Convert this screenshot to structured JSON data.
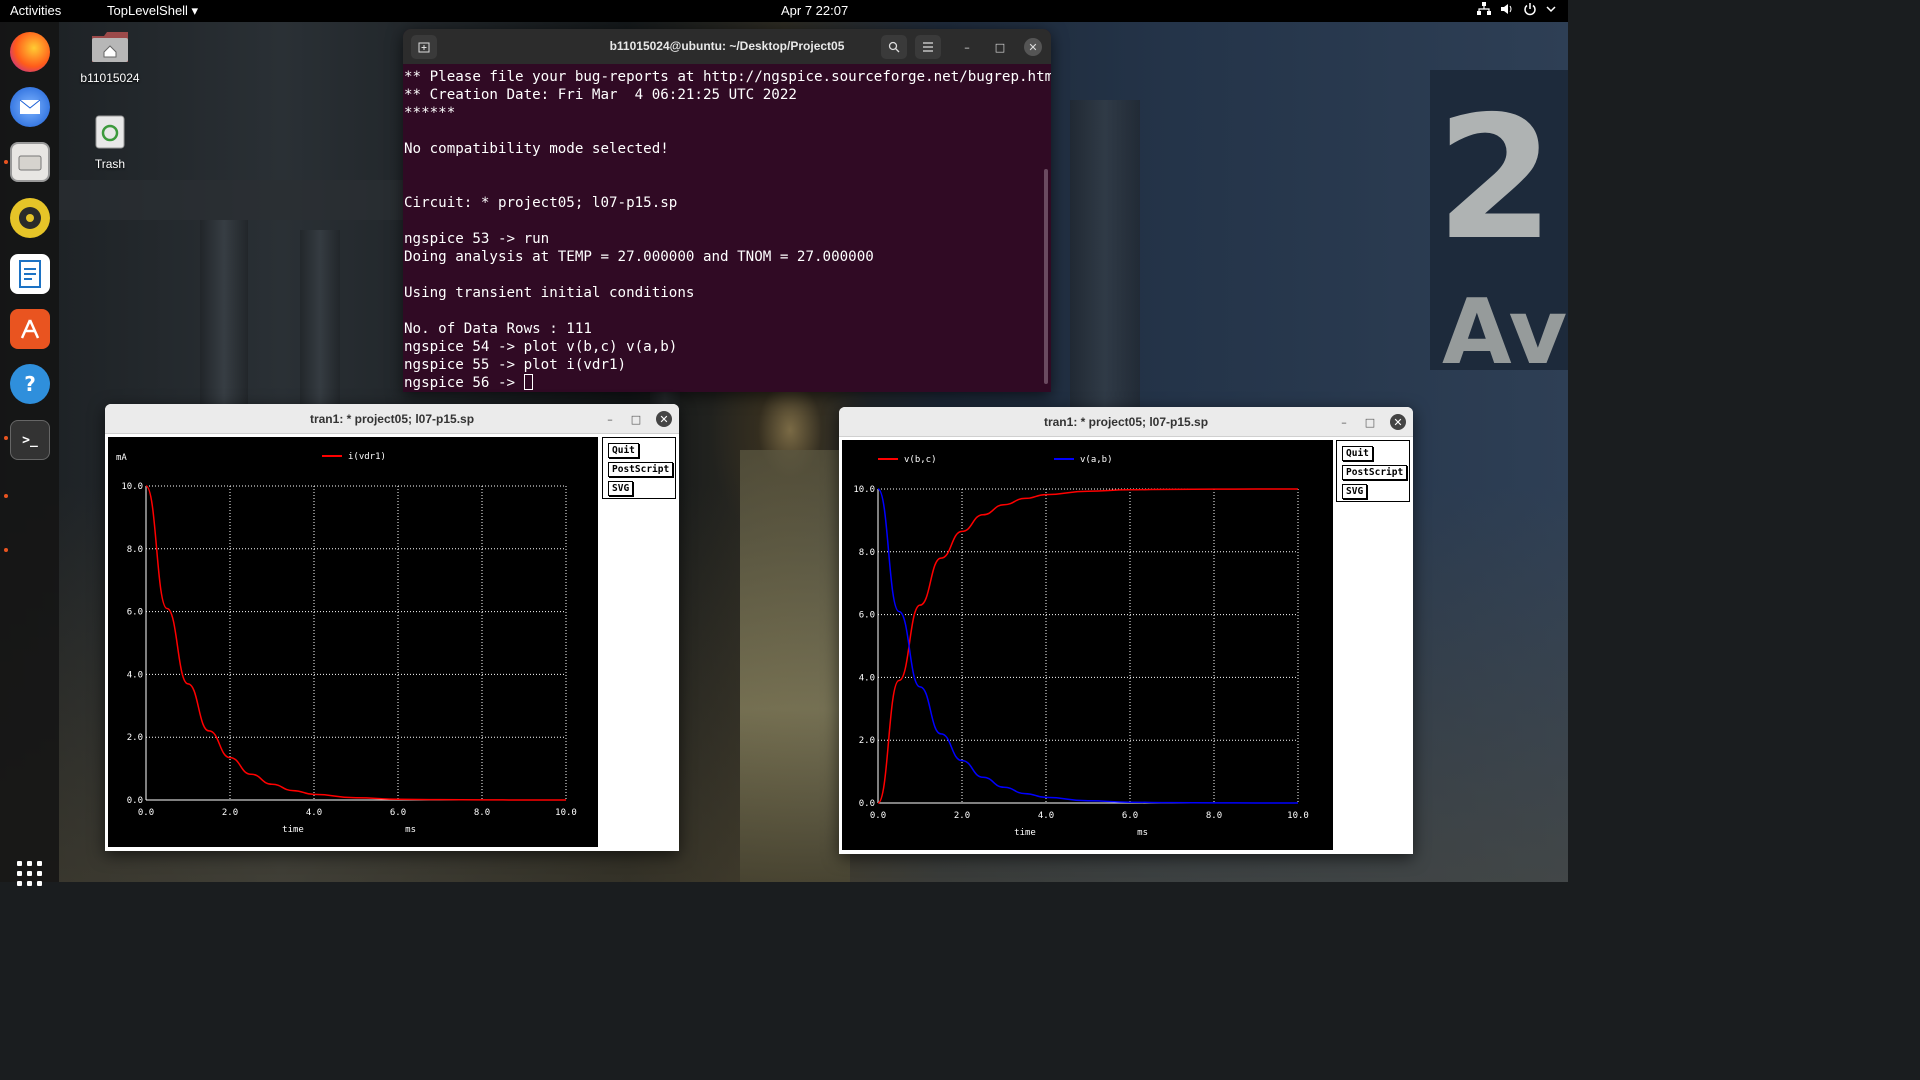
{
  "topbar": {
    "activities": "Activities",
    "app_menu": "TopLevelShell ▾",
    "clock": "Apr 7  22:07"
  },
  "desktop": {
    "home_label": "b11015024",
    "trash_label": "Trash"
  },
  "terminal": {
    "title": "b11015024@ubuntu: ~/Desktop/Project05",
    "lines": [
      "** Please file your bug-reports at http://ngspice.sourceforge.net/bugrep.html",
      "** Creation Date: Fri Mar  4 06:21:25 UTC 2022",
      "******",
      "",
      "No compatibility mode selected!",
      "",
      "",
      "Circuit: * project05; l07-p15.sp",
      "",
      "ngspice 53 -> run",
      "Doing analysis at TEMP = 27.000000 and TNOM = 27.000000",
      "",
      "Using transient initial conditions",
      "",
      "No. of Data Rows : 111",
      "ngspice 54 -> plot v(b,c) v(a,b)",
      "ngspice 55 -> plot i(vdr1)"
    ],
    "prompt": "ngspice 56 -> "
  },
  "plot_windows": [
    {
      "title": "tran1: * project05; l07-p15.sp",
      "buttons": {
        "quit": "Quit",
        "postscript": "PostScript",
        "svg": "SVG"
      }
    },
    {
      "title": "tran1: * project05; l07-p15.sp",
      "buttons": {
        "quit": "Quit",
        "postscript": "PostScript",
        "svg": "SVG"
      }
    }
  ],
  "chart_data": [
    {
      "type": "line",
      "xlabel": "time",
      "xunit": "ms",
      "yunit": "mA",
      "xlim": [
        0,
        10
      ],
      "ylim": [
        0,
        10
      ],
      "xticks": [
        "0.0",
        "2.0",
        "4.0",
        "6.0",
        "8.0",
        "10.0"
      ],
      "yticks": [
        "0.0",
        "2.0",
        "4.0",
        "6.0",
        "8.0",
        "10.0"
      ],
      "grid": true,
      "legend_position": "top",
      "x": [
        0,
        0.5,
        1,
        1.5,
        2,
        2.5,
        3,
        3.5,
        4,
        5,
        6,
        7,
        8,
        9,
        10
      ],
      "series": [
        {
          "name": "i(vdr1)",
          "color": "#ff0000",
          "values": [
            10,
            6.1,
            3.7,
            2.2,
            1.35,
            0.82,
            0.5,
            0.3,
            0.18,
            0.07,
            0.025,
            0.01,
            0.003,
            0.001,
            0
          ]
        }
      ]
    },
    {
      "type": "line",
      "xlabel": "time",
      "xunit": "ms",
      "xlim": [
        0,
        10
      ],
      "ylim": [
        0,
        10
      ],
      "xticks": [
        "0.0",
        "2.0",
        "4.0",
        "6.0",
        "8.0",
        "10.0"
      ],
      "yticks": [
        "0.0",
        "2.0",
        "4.0",
        "6.0",
        "8.0",
        "10.0"
      ],
      "grid": true,
      "legend_position": "top",
      "x": [
        0,
        0.5,
        1,
        1.5,
        2,
        2.5,
        3,
        3.5,
        4,
        5,
        6,
        7,
        8,
        9,
        10
      ],
      "series": [
        {
          "name": "v(b,c)",
          "color": "#ff0000",
          "values": [
            0,
            3.9,
            6.3,
            7.8,
            8.65,
            9.18,
            9.5,
            9.7,
            9.82,
            9.93,
            9.975,
            9.99,
            9.997,
            9.999,
            10
          ]
        },
        {
          "name": "v(a,b)",
          "color": "#0000ff",
          "values": [
            10,
            6.1,
            3.7,
            2.2,
            1.35,
            0.82,
            0.5,
            0.3,
            0.18,
            0.07,
            0.025,
            0.01,
            0.003,
            0.001,
            0
          ]
        }
      ]
    }
  ]
}
